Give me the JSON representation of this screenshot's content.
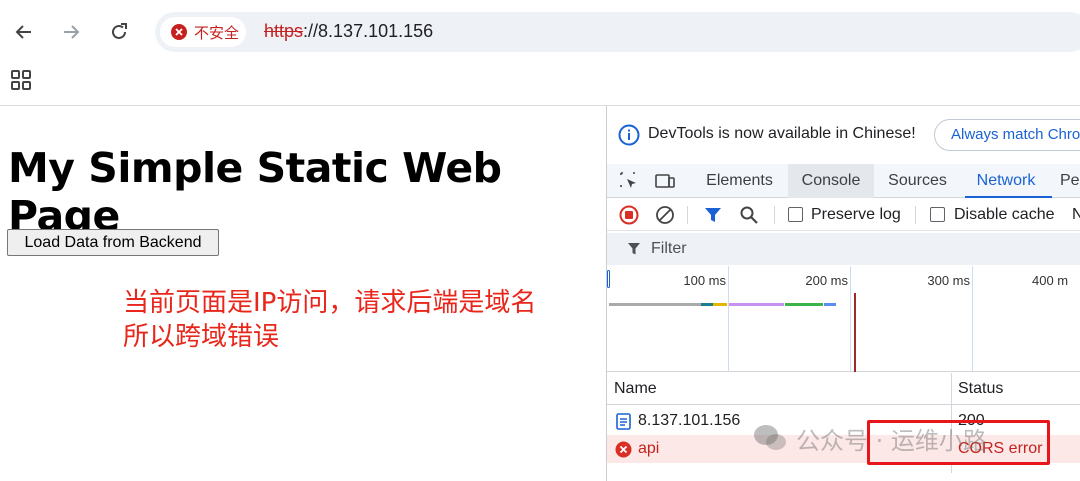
{
  "browser": {
    "security_chip_text": "不安全",
    "url_scheme": "https",
    "url_rest": "://8.137.101.156"
  },
  "page": {
    "title": "My Simple Static Web Page",
    "load_button_label": "Load Data from Backend",
    "annotation_line1": "当前页面是IP访问，请求后端是域名",
    "annotation_line2": "所以跨域错误"
  },
  "devtools": {
    "info_message": "DevTools is now available in Chinese!",
    "match_button_label": "Always match Chrome's language",
    "tabs": [
      {
        "label": "Elements"
      },
      {
        "label": "Console"
      },
      {
        "label": "Sources"
      },
      {
        "label": "Network"
      },
      {
        "label": "Pe"
      }
    ],
    "network": {
      "preserve_log_label": "Preserve log",
      "disable_cache_label": "Disable cache",
      "throttle_truncated": "N",
      "filter_placeholder": "Filter",
      "timeline_ticks": [
        "100 ms",
        "200 ms",
        "300 ms",
        "400 m"
      ],
      "columns": {
        "name": "Name",
        "status": "Status"
      },
      "requests": [
        {
          "name": "8.137.101.156",
          "status": "200",
          "type": "document"
        },
        {
          "name": "api",
          "status": "CORS error",
          "type": "error"
        }
      ]
    }
  },
  "watermark": {
    "text": "公众号 · 运维小路"
  },
  "colors": {
    "error_red": "#c5221f",
    "annotation_red": "#e8261b",
    "accent_blue": "#1a62d4"
  }
}
